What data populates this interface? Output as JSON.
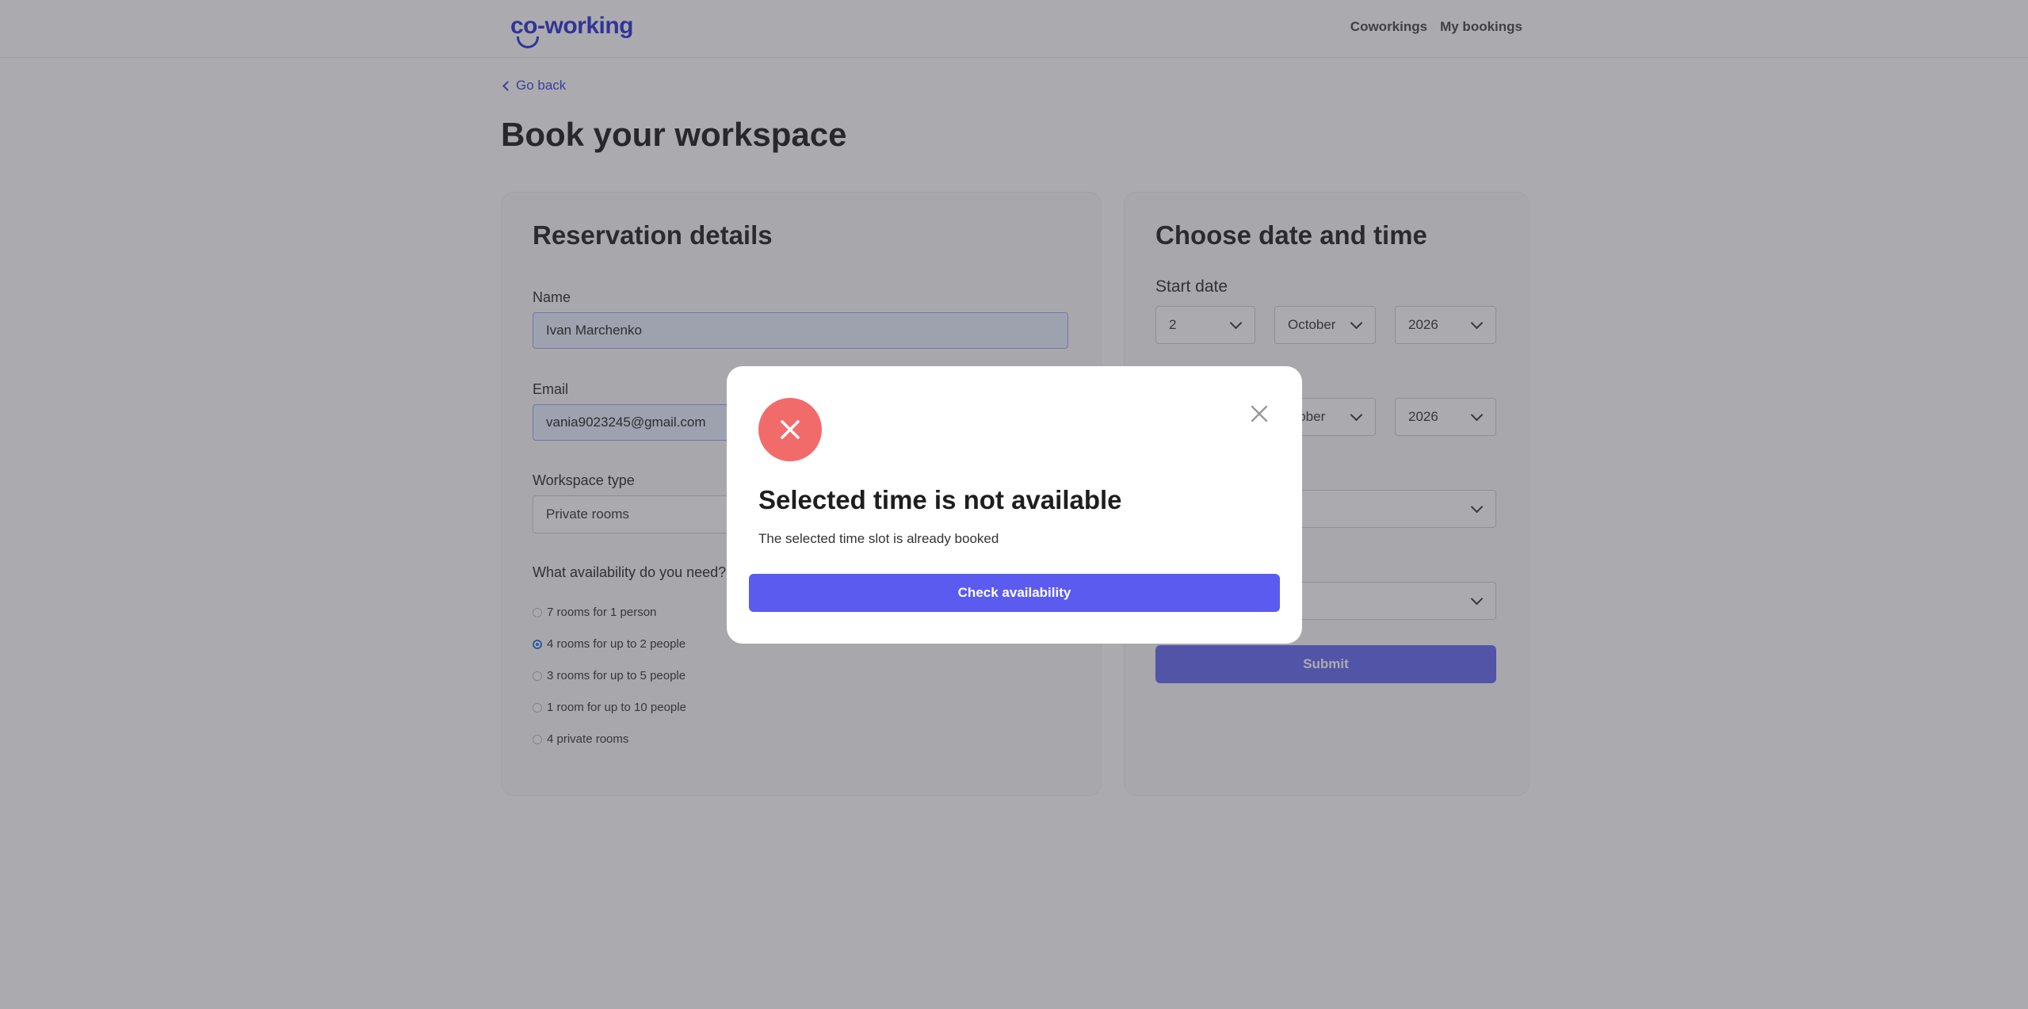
{
  "header": {
    "logo": "co-working",
    "nav": [
      {
        "label": "Coworkings"
      },
      {
        "label": "My bookings"
      }
    ]
  },
  "back_link": "Go back",
  "page_title": "Book your workspace",
  "reservation": {
    "title": "Reservation details",
    "name_label": "Name",
    "name_value": "Ivan Marchenko",
    "email_label": "Email",
    "email_value": "vania9023245@gmail.com",
    "workspace_label": "Workspace type",
    "workspace_value": "Private rooms",
    "availability_label": "What availability do you need?",
    "options": [
      {
        "label": "7 rooms for 1 person",
        "checked": false
      },
      {
        "label": "4 rooms for up to 2 people",
        "checked": true
      },
      {
        "label": "3 rooms for up to 5 people",
        "checked": false
      },
      {
        "label": "1 room for up to 10 people",
        "checked": false
      },
      {
        "label": "4 private rooms",
        "checked": false
      }
    ]
  },
  "datetime": {
    "title": "Choose date and time",
    "start_label": "Start date",
    "start_day": "2",
    "start_month": "October",
    "start_year": "2026",
    "end_month": "ctober",
    "end_year": "2026",
    "submit_label": "Submit"
  },
  "modal": {
    "title": "Selected time is not available",
    "description": "The selected time slot is already booked",
    "button": "Check availability"
  },
  "colors": {
    "accent": "#5b5bf0",
    "error": "#f26b6b",
    "brand": "#2a2fd6"
  }
}
